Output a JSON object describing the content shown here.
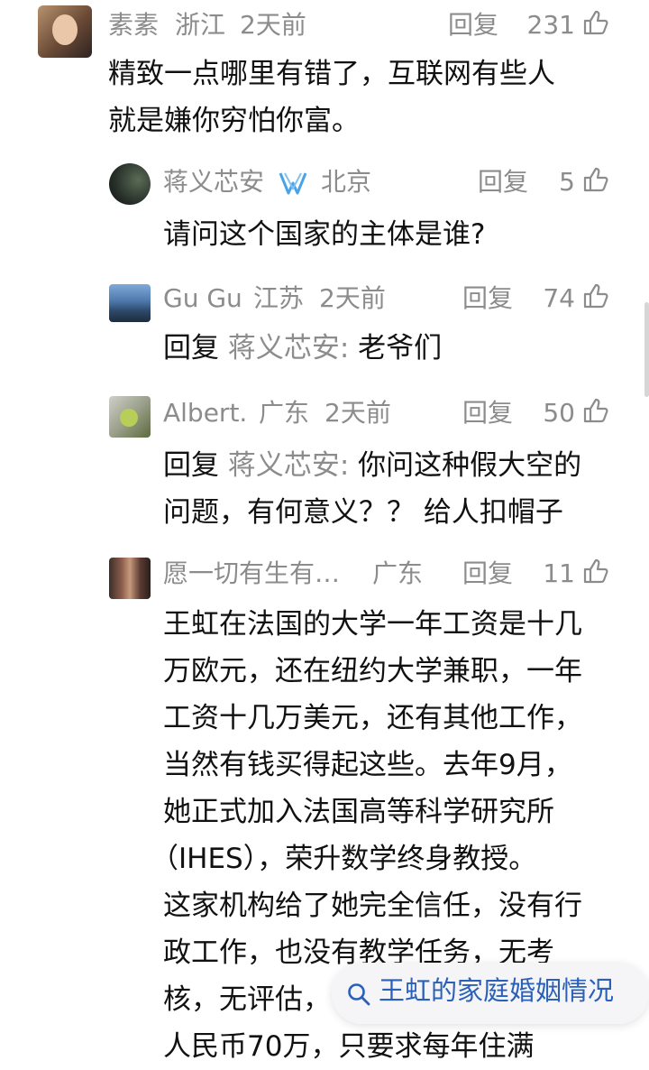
{
  "comments": [
    {
      "user": "素素",
      "location": "浙江",
      "time": "2天前",
      "reply_label": "回复",
      "likes": "231",
      "text_lines": [
        "精致一点哪里有错了，互联网有些人",
        "就是嫌你穷怕你富。"
      ]
    },
    {
      "user": "蒋义芯安",
      "location": "北京",
      "reply_label": "回复",
      "likes": "5",
      "text_lines": [
        "请问这个国家的主体是谁?"
      ]
    },
    {
      "user": "Gu Gu",
      "location": "江苏",
      "time": "2天前",
      "reply_label": "回复",
      "likes": "74",
      "reply_prefix": "回复",
      "reply_target": "蒋义芯安:",
      "text_first": "老爷们"
    },
    {
      "user": "Albert.",
      "location": "广东",
      "time": "2天前",
      "reply_label": "回复",
      "likes": "50",
      "reply_prefix": "回复",
      "reply_target": "蒋义芯安:",
      "text_first": "你问这种假大空的",
      "text_lines": [
        "问题，有何意义？？ 给人扣帽子"
      ]
    },
    {
      "user": "愿一切有生有…",
      "location": "广东",
      "reply_label": "回复",
      "likes": "11",
      "text_lines": [
        "王虹在法国的大学一年工资是十几",
        "万欧元，还在纽约大学兼职，一年",
        "工资十几万美元，还有其他工作，",
        "当然有钱买得起这些。去年9月，",
        "她正式加入法国高等科学研究所",
        "（IHES），荣升数学终身教授。",
        "这家机构给了她完全信任，没有行",
        "政工作，也没有教学任务，无考",
        "核，无评估，",
        "人民币70万，只要求每年住满"
      ]
    }
  ],
  "search": {
    "icon": "search-icon",
    "text": "王虹的家庭婚姻情况"
  },
  "colors": {
    "meta": "#8c8c8c",
    "text": "#111111",
    "search_text": "#2a60b8",
    "verified_badge": "#4aa3e8"
  }
}
